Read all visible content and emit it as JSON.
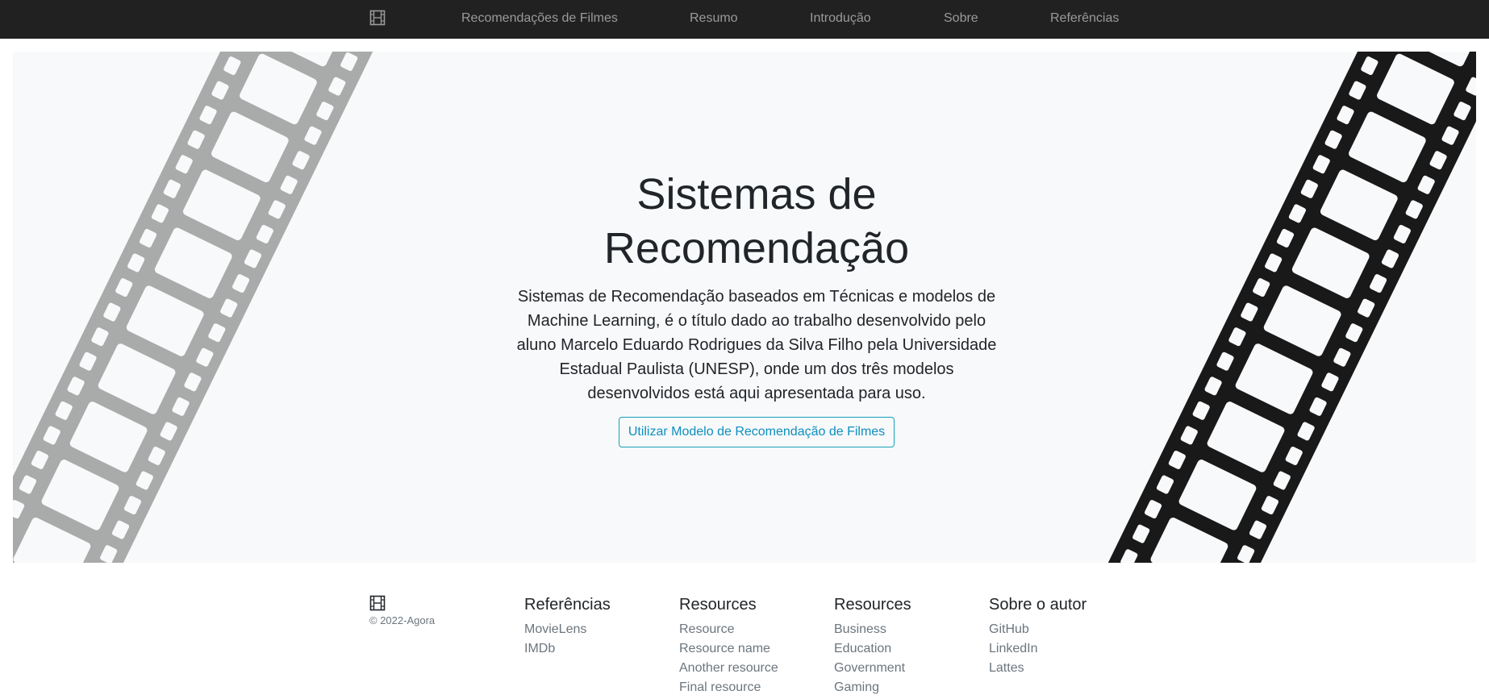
{
  "nav": {
    "logo_icon": "film-icon",
    "links": [
      {
        "label": "Recomendações de Filmes"
      },
      {
        "label": "Resumo"
      },
      {
        "label": "Introdução"
      },
      {
        "label": "Sobre"
      },
      {
        "label": "Referências"
      }
    ]
  },
  "hero": {
    "title_line1": "Sistemas de",
    "title_line2": "Recomendação",
    "description": "Sistemas de Recomendação baseados em Técnicas e modelos de Machine Learning, é o título dado ao trabalho desenvolvido pelo aluno Marcelo Eduardo Rodrigues da Silva Filho pela Universidade Estadual Paulista (UNESP), onde um dos três modelos desenvolvidos está aqui apresentada para uso.",
    "button_label": "Utilizar Modelo de Recomendação de Filmes",
    "left_strip_icon": "film-strip-gray",
    "right_strip_icon": "film-strip-black"
  },
  "footer": {
    "logo_icon": "film-icon",
    "copyright": "© 2022-Agora",
    "columns": [
      {
        "heading": "Referências",
        "links": [
          "MovieLens",
          "IMDb"
        ]
      },
      {
        "heading": "Resources",
        "links": [
          "Resource",
          "Resource name",
          "Another resource",
          "Final resource"
        ]
      },
      {
        "heading": "Resources",
        "links": [
          "Business",
          "Education",
          "Government",
          "Gaming"
        ]
      },
      {
        "heading": "Sobre o autor",
        "links": [
          "GitHub",
          "LinkedIn",
          "Lattes"
        ]
      }
    ]
  },
  "colors": {
    "navbar_bg": "#212121",
    "hero_bg": "#f8f9fa",
    "strip_gray": "#a9abaa",
    "strip_black": "#191919",
    "button_accent": "#17a2b8"
  }
}
